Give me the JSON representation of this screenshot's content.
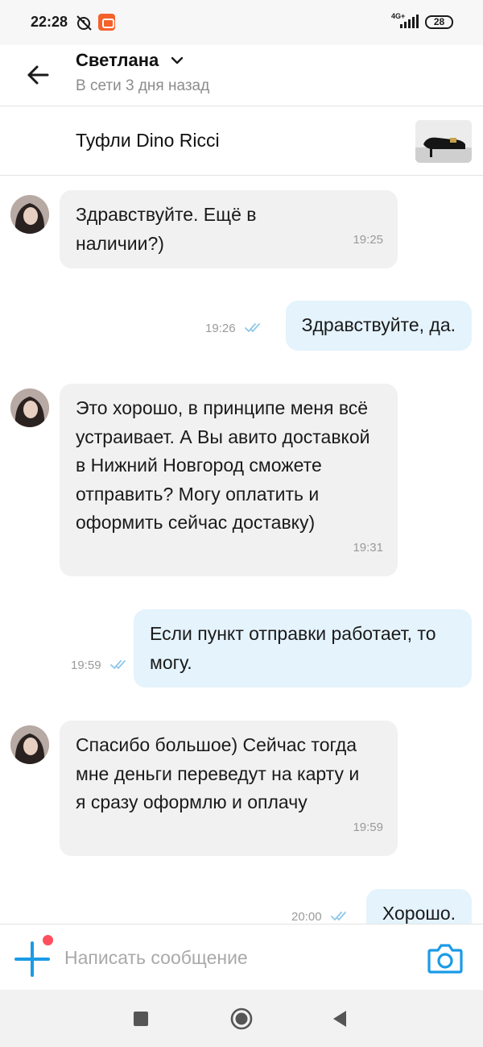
{
  "status_bar": {
    "time": "22:28",
    "network": "4G+",
    "battery": "28"
  },
  "header": {
    "contact_name": "Светлана",
    "contact_status": "В сети 3 дня назад"
  },
  "listing": {
    "title": "Туфли Dino Ricci"
  },
  "messages": [
    {
      "direction": "in",
      "text": "Здравствуйте. Ещё в наличии?)",
      "time": "19:25"
    },
    {
      "direction": "out",
      "text": "Здравствуйте, да.",
      "time": "19:26",
      "read": true
    },
    {
      "direction": "in",
      "text": "Это хорошо, в принципе меня всё устраивает. А Вы авито доставкой в Нижний Новгород сможете отправить? Могу оплатить и оформить сейчас доставку)",
      "time": "19:31"
    },
    {
      "direction": "out",
      "text": "Если пункт отправки работает, то могу.",
      "time": "19:59",
      "read": true
    },
    {
      "direction": "in",
      "text": "Спасибо большое) Сейчас тогда мне деньги переведут на карту и я сразу оформлю и оплачу",
      "time": "19:59"
    },
    {
      "direction": "out",
      "text": "Хорошо.",
      "time": "20:00",
      "read": true
    }
  ],
  "composer": {
    "placeholder": "Написать сообщение"
  },
  "icons": {
    "back": "arrow-left-icon",
    "add": "plus-icon",
    "camera": "camera-icon",
    "read_receipt": "double-check-icon"
  },
  "colors": {
    "accent": "#1a9be6",
    "incoming_bubble": "#f1f1f1",
    "outgoing_bubble": "#e4f3fc",
    "notification_dot": "#ff4f5e"
  }
}
